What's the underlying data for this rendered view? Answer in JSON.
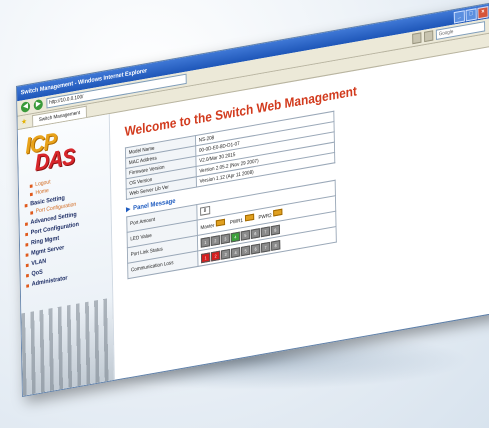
{
  "window": {
    "title": "Switch Management - Windows Internet Explorer",
    "controls": [
      "_",
      "□",
      "×"
    ]
  },
  "browser": {
    "url": "http://10.0.0.100/",
    "search_placeholder": "Google",
    "tab_label": "Switch Management"
  },
  "logo": {
    "line1": "ICP",
    "line2": "DAS"
  },
  "sidebar": {
    "items": [
      {
        "label": "Logout",
        "kind": "sub"
      },
      {
        "label": "Home",
        "kind": "sub"
      },
      {
        "label": "Basic Setting",
        "kind": "main"
      },
      {
        "label": "Port Configuration",
        "kind": "sub"
      },
      {
        "label": "Advanced Setting",
        "kind": "main"
      },
      {
        "label": "Port Configuration",
        "kind": "main"
      },
      {
        "label": "Ring Mgmt",
        "kind": "main"
      },
      {
        "label": "Mgmt Server",
        "kind": "main"
      },
      {
        "label": "VLAN",
        "kind": "main"
      },
      {
        "label": "QoS",
        "kind": "main"
      },
      {
        "label": "Administrator",
        "kind": "main"
      }
    ]
  },
  "main": {
    "title": "Welcome to the Switch Web Management",
    "info": [
      {
        "key": "Model Name",
        "value": "NS-208"
      },
      {
        "key": "MAC Address",
        "value": "00-0D-E0-8D-D1-07"
      },
      {
        "key": "Firmware Version",
        "value": "V2.0/Mar 30 2015"
      },
      {
        "key": "OS Version",
        "value": "Version 2.05.2 (Nov 29 2007)"
      },
      {
        "key": "Web Server Lib Ver",
        "value": "Version 1.12 (Apr 11 2008)"
      }
    ],
    "panel_heading": "Panel Message",
    "panel": {
      "port_amount_label": "Port Amount",
      "port_amount_value": "8",
      "led_label": "LED Value",
      "leds": [
        {
          "label": "Master",
          "on": true
        },
        {
          "label": "PWR1",
          "on": true
        },
        {
          "label": "PWR2",
          "on": true
        }
      ],
      "link_label": "Port Link Status",
      "link_ports": [
        {
          "num": "1",
          "state": "off"
        },
        {
          "num": "2",
          "state": "off"
        },
        {
          "num": "3",
          "state": "off"
        },
        {
          "num": "4",
          "state": "up"
        },
        {
          "num": "5",
          "state": "off"
        },
        {
          "num": "6",
          "state": "off"
        },
        {
          "num": "7",
          "state": "off"
        },
        {
          "num": "8",
          "state": "off"
        }
      ],
      "comm_label": "Communication Loss",
      "comm_ports": [
        {
          "num": "1",
          "state": "err"
        },
        {
          "num": "2",
          "state": "err"
        },
        {
          "num": "3",
          "state": "off"
        },
        {
          "num": "4",
          "state": "off"
        },
        {
          "num": "5",
          "state": "off"
        },
        {
          "num": "6",
          "state": "off"
        },
        {
          "num": "7",
          "state": "off"
        },
        {
          "num": "8",
          "state": "off"
        }
      ]
    }
  },
  "colors": {
    "title_red": "#d23b1e",
    "section_blue": "#1f5cc0",
    "port_up": "#3ca03c",
    "port_err": "#d42020",
    "led_on": "#e0a020"
  }
}
